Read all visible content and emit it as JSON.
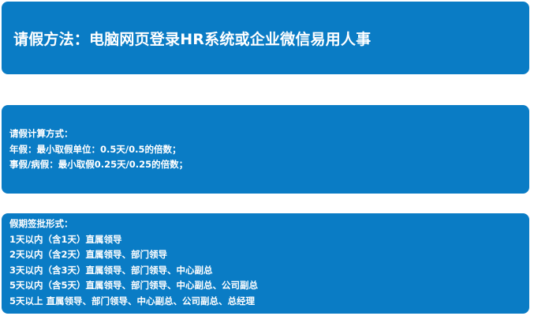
{
  "header": {
    "title": "请假方法：电脑网页登录HR系统或企业微信易用人事"
  },
  "calculation": {
    "heading": "请假计算方式：",
    "annual": "年假：最小取假单位：0.5天/0.5的倍数；",
    "personal_sick": "事假/病假：最小取假0.25天/0.25的倍数；"
  },
  "approval": {
    "heading": "假期签批形式：",
    "rules": [
      "1天以内（含1天）直属领导",
      "2天以内（含2天）直属领导、部门领导",
      "3天以内（含3天）直属领导、部门领导、中心副总",
      "5天以内（含5天）直属领导、部门领导、中心副总、公司副总",
      "5天以上 直属领导、部门领导、中心副总、公司副总、总经理"
    ]
  },
  "colors": {
    "panel_background": "#0a7cc5",
    "text": "#ffffff",
    "page_background": "#ffffff"
  }
}
